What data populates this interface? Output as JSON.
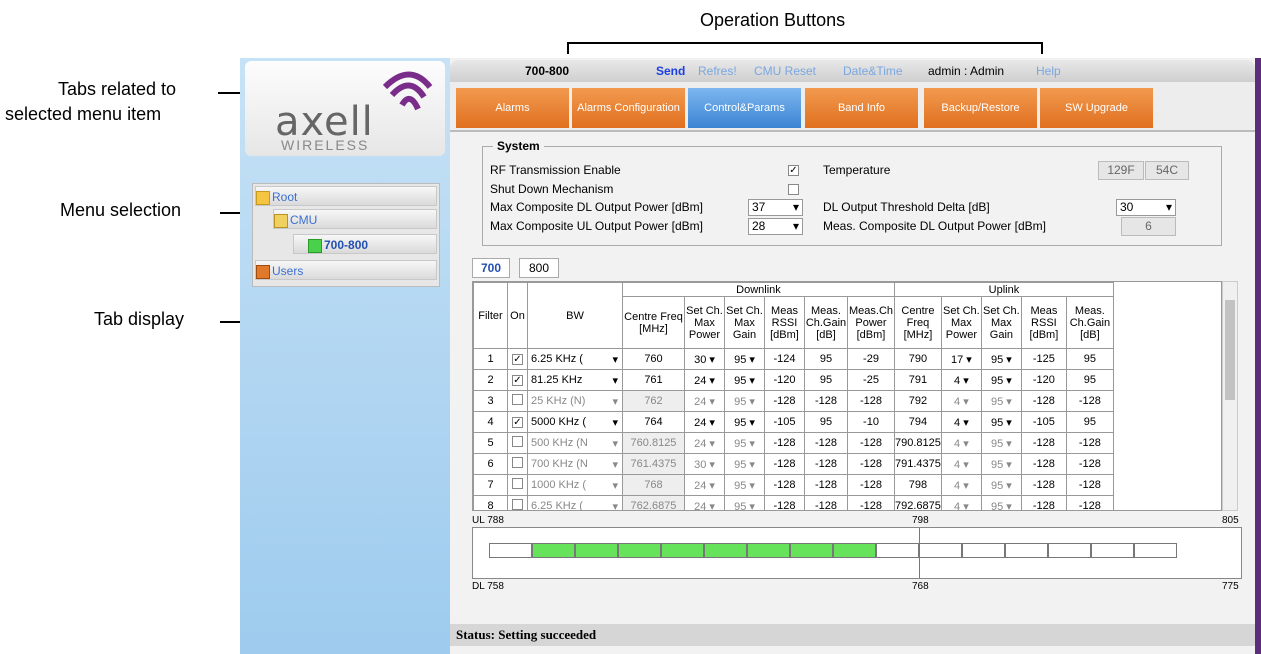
{
  "annotations": {
    "operation_buttons": "Operation Buttons",
    "tabs_related": "Tabs related to",
    "tabs_related2": "selected menu item",
    "menu_selection": "Menu selection",
    "tab_display": "Tab display"
  },
  "logo": {
    "word": "axell",
    "sub": "WIRELESS"
  },
  "tree": {
    "root": "Root",
    "cmu": "CMU",
    "band": "700-800",
    "users": "Users"
  },
  "topbar": {
    "device": "700-800",
    "send": "Send",
    "refresh": "Refres!",
    "cmu_reset": "CMU Reset",
    "datetime": "Date&Time",
    "user": "admin : Admin",
    "help": "Help"
  },
  "tabs": [
    "Alarms",
    "Alarms Configuration",
    "Control&Params",
    "Band Info",
    "Backup/Restore",
    "SW Upgrade"
  ],
  "system": {
    "legend": "System",
    "rf_enable": "RF Transmission Enable",
    "shutdown": "Shut Down Mechanism",
    "max_dl": "Max Composite DL Output Power [dBm]",
    "max_dl_val": "37",
    "max_ul": "Max Composite UL Output Power [dBm]",
    "max_ul_val": "28",
    "temperature": "Temperature",
    "temp_f": "129F",
    "temp_c": "54C",
    "dl_threshold": "DL Output Threshold Delta [dB]",
    "dl_threshold_val": "30",
    "meas_dl": "Meas. Composite DL Output Power [dBm]",
    "meas_dl_val": "6"
  },
  "band_tabs": [
    "700",
    "800"
  ],
  "table": {
    "downlink": "Downlink",
    "uplink": "Uplink",
    "h_filter": "Filter",
    "h_on": "On",
    "h_bw": "BW",
    "h_centre": "Centre Freq [MHz]",
    "h_setmax": "Set Ch. Max Power",
    "h_setgain": "Set Ch. Max Gain",
    "h_rssi": "Meas RSSI [dBm]",
    "h_chgain": "Meas. Ch.Gain [dB]",
    "h_chpower": "Meas.Ch Power [dBm]",
    "h_ul_rssi": "Meas RSSI [dBm]",
    "h_ul_chgain": "Meas. Ch.Gain [dB]",
    "rows": [
      {
        "f": "1",
        "on": true,
        "bw": "6.25 KHz (",
        "dcf": "760",
        "dmp": "30",
        "dmg": "95",
        "drssi": "-124",
        "dgain": "95",
        "dpow": "-29",
        "ucf": "790",
        "ump": "17",
        "umg": "95",
        "urssi": "-125",
        "ugain": "95",
        "dis": false
      },
      {
        "f": "2",
        "on": true,
        "bw": "81.25 KHz",
        "dcf": "761",
        "dmp": "24",
        "dmg": "95",
        "drssi": "-120",
        "dgain": "95",
        "dpow": "-25",
        "ucf": "791",
        "ump": "4",
        "umg": "95",
        "urssi": "-120",
        "ugain": "95",
        "dis": false
      },
      {
        "f": "3",
        "on": false,
        "bw": "25 KHz (N)",
        "dcf": "762",
        "dmp": "24",
        "dmg": "95",
        "drssi": "-128",
        "dgain": "-128",
        "dpow": "-128",
        "ucf": "792",
        "ump": "4",
        "umg": "95",
        "urssi": "-128",
        "ugain": "-128",
        "dis": true
      },
      {
        "f": "4",
        "on": true,
        "bw": "5000 KHz (",
        "dcf": "764",
        "dmp": "24",
        "dmg": "95",
        "drssi": "-105",
        "dgain": "95",
        "dpow": "-10",
        "ucf": "794",
        "ump": "4",
        "umg": "95",
        "urssi": "-105",
        "ugain": "95",
        "dis": false
      },
      {
        "f": "5",
        "on": false,
        "bw": "500 KHz (N",
        "dcf": "760.8125",
        "dmp": "24",
        "dmg": "95",
        "drssi": "-128",
        "dgain": "-128",
        "dpow": "-128",
        "ucf": "790.8125",
        "ump": "4",
        "umg": "95",
        "urssi": "-128",
        "ugain": "-128",
        "dis": true
      },
      {
        "f": "6",
        "on": false,
        "bw": "700 KHz (N",
        "dcf": "761.4375",
        "dmp": "30",
        "dmg": "95",
        "drssi": "-128",
        "dgain": "-128",
        "dpow": "-128",
        "ucf": "791.4375",
        "ump": "4",
        "umg": "95",
        "urssi": "-128",
        "ugain": "-128",
        "dis": true
      },
      {
        "f": "7",
        "on": false,
        "bw": "1000 KHz (",
        "dcf": "768",
        "dmp": "24",
        "dmg": "95",
        "drssi": "-128",
        "dgain": "-128",
        "dpow": "-128",
        "ucf": "798",
        "ump": "4",
        "umg": "95",
        "urssi": "-128",
        "ugain": "-128",
        "dis": true
      },
      {
        "f": "8",
        "on": false,
        "bw": "6.25 KHz (",
        "dcf": "762.6875",
        "dmp": "24",
        "dmg": "95",
        "drssi": "-128",
        "dgain": "-128",
        "dpow": "-128",
        "ucf": "792.6875",
        "ump": "4",
        "umg": "95",
        "urssi": "-128",
        "ugain": "-128",
        "dis": true
      }
    ]
  },
  "spectrum": {
    "ul_start": "UL 788",
    "ul_mid": "798",
    "ul_end": "805",
    "dl_start": "DL 758",
    "dl_mid": "768",
    "dl_end": "775",
    "cells": 16,
    "active": [
      1,
      2,
      3,
      4,
      5,
      6,
      7,
      8
    ],
    "active_color": "#66e35a"
  },
  "status": "Status: Setting succeeded",
  "colors": {
    "tab_orange": "#e8822f",
    "tab_active": "#4a90d9",
    "frame_purple": "#5b2d7a"
  }
}
